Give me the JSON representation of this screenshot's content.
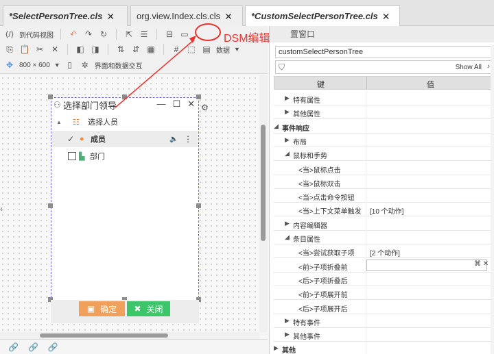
{
  "tabs": [
    {
      "label": "*SelectPersonTree.cls",
      "active": false
    },
    {
      "label": "org.view.Index.cls.cls",
      "active": false
    },
    {
      "label": "*CustomSelectPersonTree.cls",
      "active": true
    }
  ],
  "toolbar": {
    "to_code_view": "到代码视图",
    "data_label": "数据",
    "size_label": "800 × 600",
    "ui_data_interaction": "界面和数据交互"
  },
  "annotation": {
    "text": "DSM编辑器入口"
  },
  "dialog": {
    "title": "选择部门领导",
    "root_node": "选择人员",
    "node_member": "成员",
    "node_dept": "部门",
    "ok_label": "确定",
    "close_label": "关闭"
  },
  "properties": {
    "title_tail": "置窗口",
    "selected_object": "customSelectPersonTree",
    "show_all": "Show All",
    "col_key": "键",
    "col_value": "值",
    "rows": [
      {
        "key": "特有属性",
        "value": ""
      },
      {
        "key": "其他属性",
        "value": ""
      },
      {
        "key": "事件响应",
        "value": ""
      },
      {
        "key": "布局",
        "value": ""
      },
      {
        "key": "鼠标和手势",
        "value": ""
      },
      {
        "key": "<当>鼠标点击",
        "value": ""
      },
      {
        "key": "<当>鼠标双击",
        "value": ""
      },
      {
        "key": "<当>点击命令按钮",
        "value": ""
      },
      {
        "key": "<当>上下文菜单触发",
        "value": "[10 个动作]"
      },
      {
        "key": "内容编辑器",
        "value": ""
      },
      {
        "key": "条目属性",
        "value": ""
      },
      {
        "key": "<当>尝试获取子项",
        "value": "[2 个动作]"
      },
      {
        "key": "<前>子项折叠前",
        "value": ""
      },
      {
        "key": "<后>子项折叠后",
        "value": ""
      },
      {
        "key": "<前>子项展开前",
        "value": ""
      },
      {
        "key": "<后>子项展开后",
        "value": ""
      },
      {
        "key": "特有事件",
        "value": ""
      },
      {
        "key": "其他事件",
        "value": ""
      },
      {
        "key": "其他",
        "value": ""
      }
    ]
  },
  "colors": {
    "annotation_red": "#e8322c",
    "ok_orange": "#f0a05a",
    "close_green": "#3cc56a"
  }
}
